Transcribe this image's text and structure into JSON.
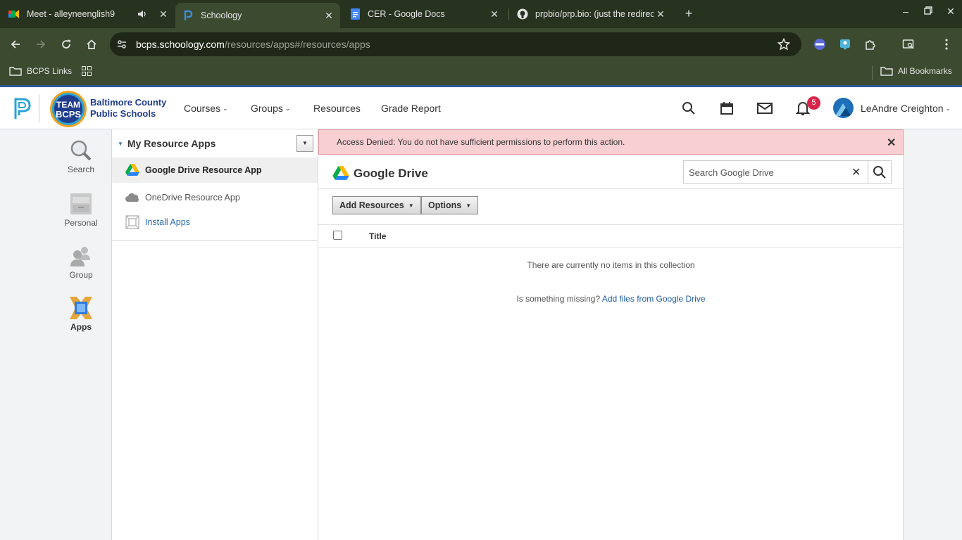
{
  "browser": {
    "tabs": [
      {
        "title": "Meet - alleyneenglish9",
        "icon": "google-meet-icon",
        "audio": true
      },
      {
        "title": "Schoology",
        "icon": "schoology-icon",
        "active": true
      },
      {
        "title": "CER - Google Docs",
        "icon": "google-docs-icon"
      },
      {
        "title": "prpbio/prp.bio: (just the redirec",
        "icon": "github-icon"
      }
    ],
    "url_domain": "bcps.schoology.com",
    "url_path": "/resources/apps#/resources/apps",
    "bookmarks": {
      "left": "BCPS Links",
      "right": "All Bookmarks"
    }
  },
  "header": {
    "logo_line1": "Baltimore County",
    "logo_line2": "Public Schools",
    "logo_badge_top": "TEAM",
    "logo_badge_bottom": "BCPS",
    "nav": [
      "Courses",
      "Groups",
      "Resources",
      "Grade Report"
    ],
    "notifications_count": "5",
    "user_name": "LeAndre Creighton"
  },
  "rail": [
    {
      "label": "Search",
      "icon": "magnifier-icon"
    },
    {
      "label": "Personal",
      "icon": "cabinet-icon"
    },
    {
      "label": "Group",
      "icon": "people-icon"
    },
    {
      "label": "Apps",
      "icon": "apps-icon",
      "active": true
    }
  ],
  "apps_panel": {
    "heading": "My Resource Apps",
    "items": [
      {
        "label": "Google Drive Resource App",
        "selected": true
      },
      {
        "label": "OneDrive Resource App"
      },
      {
        "label": "Install Apps"
      }
    ]
  },
  "main": {
    "alert": "Access Denied: You do not have sufficient permissions to perform this action.",
    "title": "Google Drive",
    "search_placeholder": "Search Google Drive",
    "add_resources": "Add Resources",
    "options": "Options",
    "col_title": "Title",
    "empty_msg": "There are currently no items in this collection",
    "missing_prefix": "Is something missing?",
    "missing_link": "Add files from Google Drive"
  },
  "colors": {
    "browser_frame": "#27321f",
    "toolbar": "#3c4a30",
    "alert_bg": "#f8cfd2",
    "link": "#1d5ca3",
    "badge": "#d9254a"
  }
}
